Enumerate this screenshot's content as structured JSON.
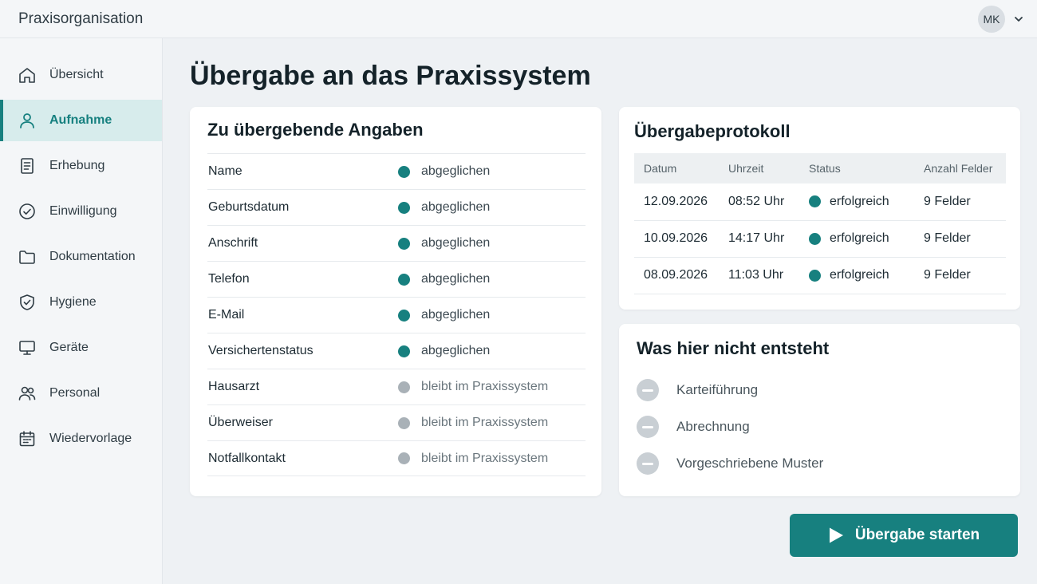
{
  "app": {
    "title": "Praxisorganisation"
  },
  "user": {
    "initials": "MK"
  },
  "sidebar": {
    "items": [
      {
        "label": "Übersicht",
        "icon": "home-icon"
      },
      {
        "label": "Aufnahme",
        "icon": "user-icon",
        "active": true
      },
      {
        "label": "Erhebung",
        "icon": "document-icon"
      },
      {
        "label": "Einwilligung",
        "icon": "check-circle-icon"
      },
      {
        "label": "Dokumentation",
        "icon": "folder-icon"
      },
      {
        "label": "Hygiene",
        "icon": "shield-icon"
      },
      {
        "label": "Geräte",
        "icon": "monitor-icon"
      },
      {
        "label": "Personal",
        "icon": "users-icon"
      },
      {
        "label": "Wiedervorlage",
        "icon": "calendar-icon"
      }
    ]
  },
  "main": {
    "title": "Übergabe an das Praxissystem",
    "fields_card": {
      "title": "Zu übergebende Angaben",
      "rows": [
        {
          "name": "Name",
          "status": "abgeglichen",
          "kind": "ok"
        },
        {
          "name": "Geburtsdatum",
          "status": "abgeglichen",
          "kind": "ok"
        },
        {
          "name": "Anschrift",
          "status": "abgeglichen",
          "kind": "ok"
        },
        {
          "name": "Telefon",
          "status": "abgeglichen",
          "kind": "ok"
        },
        {
          "name": "E-Mail",
          "status": "abgeglichen",
          "kind": "ok"
        },
        {
          "name": "Versichertenstatus",
          "status": "abgeglichen",
          "kind": "ok"
        },
        {
          "name": "Hausarzt",
          "status": "bleibt im Praxissystem",
          "kind": "stay"
        },
        {
          "name": "Überweiser",
          "status": "bleibt im Praxissystem",
          "kind": "stay"
        },
        {
          "name": "Notfallkontakt",
          "status": "bleibt im Praxissystem",
          "kind": "stay"
        }
      ]
    },
    "protocol_card": {
      "title": "Übergabeprotokoll",
      "columns": [
        "Datum",
        "Uhrzeit",
        "Status",
        "Anzahl Felder"
      ],
      "rows": [
        {
          "date": "12.09.2026",
          "time": "08:52 Uhr",
          "status": "erfolgreich",
          "count": "9 Felder"
        },
        {
          "date": "10.09.2026",
          "time": "14:17 Uhr",
          "status": "erfolgreich",
          "count": "9 Felder"
        },
        {
          "date": "08.09.2026",
          "time": "11:03 Uhr",
          "status": "erfolgreich",
          "count": "9 Felder"
        }
      ]
    },
    "not_created_card": {
      "title": "Was hier nicht entsteht",
      "items": [
        "Karteiführung",
        "Abrechnung",
        "Vorgeschriebene Muster"
      ]
    },
    "start_button": {
      "label": "Übergabe starten"
    }
  },
  "colors": {
    "accent": "#17807f",
    "active_bg": "#d7ecec",
    "status_ok": "#17807f",
    "status_stay": "#a9b1b7"
  }
}
